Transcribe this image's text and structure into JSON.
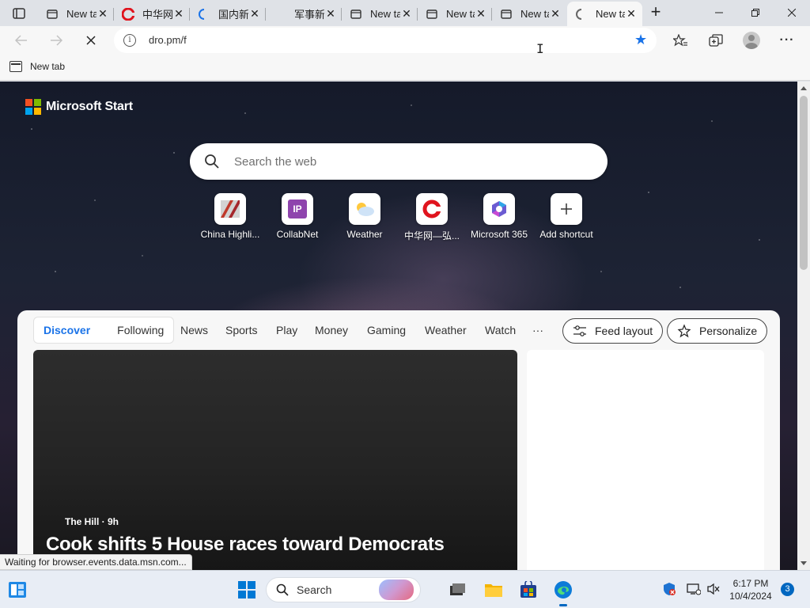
{
  "browser": {
    "tabs": [
      {
        "title": "New tab",
        "favicon": "newtab-icon",
        "active": false
      },
      {
        "title": "中华网",
        "favicon": "chinanet-icon",
        "active": false
      },
      {
        "title": "国内新闻",
        "favicon": "loading-icon",
        "active": false
      },
      {
        "title": "军事新闻",
        "favicon": "none",
        "active": false
      },
      {
        "title": "New tab",
        "favicon": "newtab-icon",
        "active": false
      },
      {
        "title": "New tab",
        "favicon": "newtab-icon",
        "active": false
      },
      {
        "title": "New tab",
        "favicon": "newtab-icon",
        "active": false
      },
      {
        "title": "New tab",
        "favicon": "loading-icon",
        "active": true
      }
    ],
    "address_url": "dro.pm/f",
    "favorites_bar": [
      {
        "label": "New tab"
      }
    ]
  },
  "msn": {
    "brand": "Microsoft Start",
    "search_placeholder": "Search the web",
    "shortcuts": [
      {
        "label": "China Highli...",
        "icon": "china-highlights-icon"
      },
      {
        "label": "CollabNet",
        "icon": "collabnet-icon"
      },
      {
        "label": "Weather",
        "icon": "weather-icon"
      },
      {
        "label": "中华网—弘...",
        "icon": "chinanet-icon"
      },
      {
        "label": "Microsoft 365",
        "icon": "m365-icon"
      },
      {
        "label": "Add shortcut",
        "icon": "plus-icon"
      }
    ],
    "feed_pivots": [
      "Discover",
      "Following"
    ],
    "feed_nav": [
      "News",
      "Sports",
      "Play",
      "Money",
      "Gaming",
      "Weather",
      "Watch"
    ],
    "more_label": "···",
    "feed_layout_label": "Feed layout",
    "personalize_label": "Personalize",
    "hero": {
      "source": "The Hill · 9h",
      "headline": "Cook shifts 5 House races toward Democrats"
    }
  },
  "status_text": "Waiting for browser.events.data.msn.com...",
  "taskbar": {
    "search_label": "Search",
    "time": "6:17 PM",
    "date": "10/4/2024",
    "notification_count": "3"
  },
  "colors": {
    "accent": "#1a73e8",
    "ms_red": "#f25022",
    "ms_green": "#7fba00",
    "ms_blue": "#00a4ef",
    "ms_yellow": "#ffb900"
  }
}
